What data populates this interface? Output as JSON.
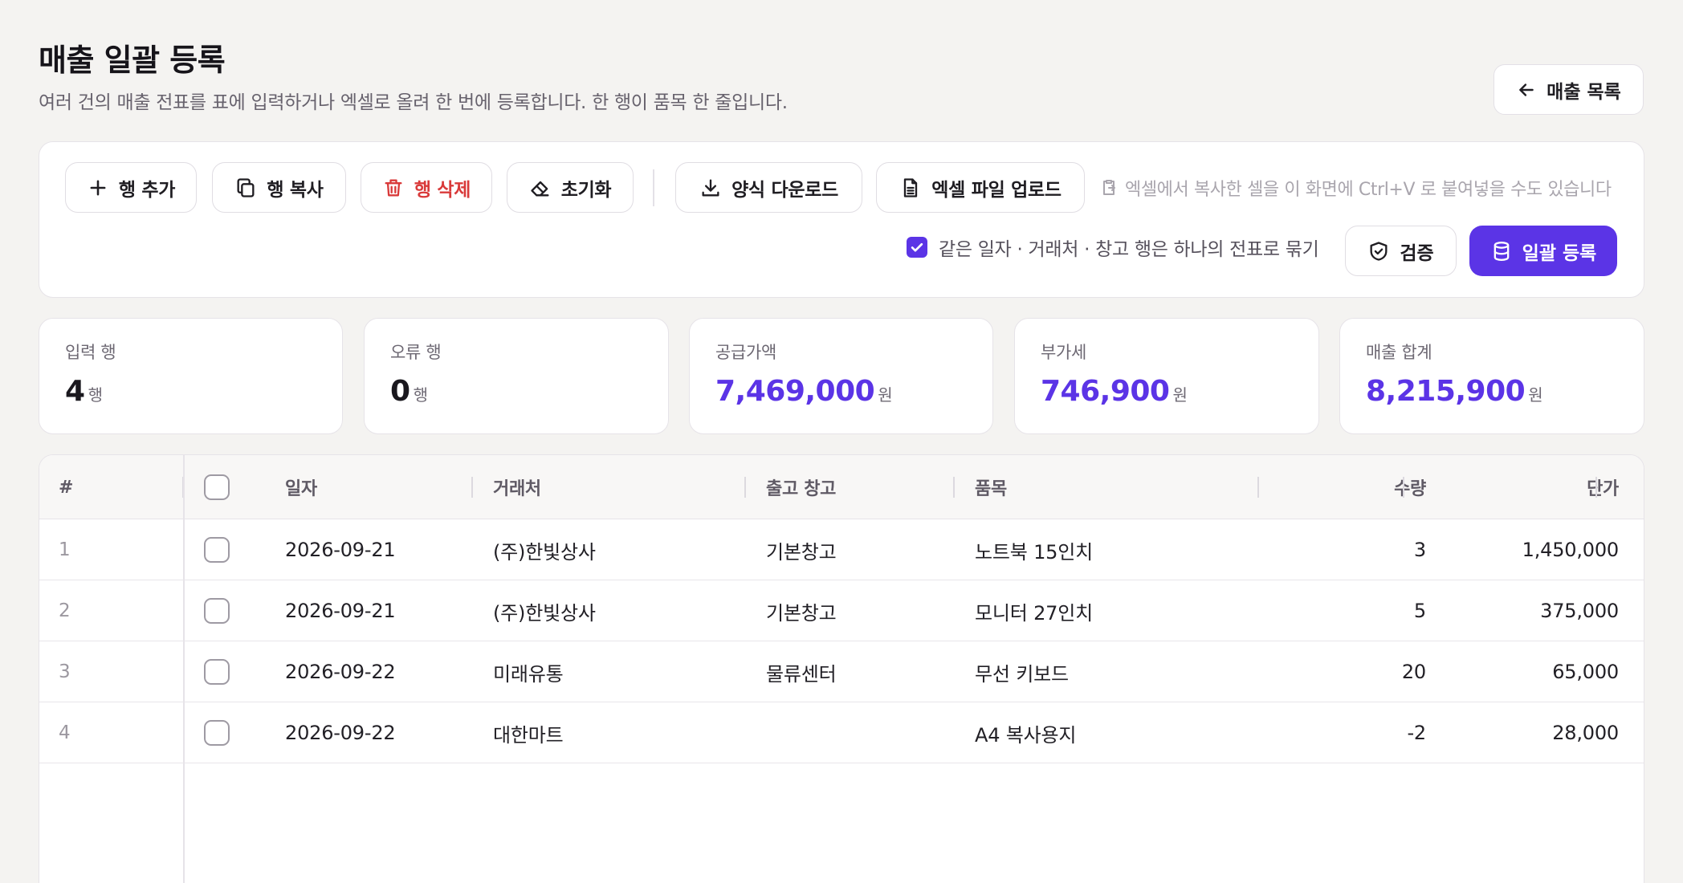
{
  "header": {
    "title": "매출 일괄 등록",
    "subtitle": "여러 건의 매출 전표를 표에 입력하거나 엑셀로 올려 한 번에 등록합니다. 한 행이 품목 한 줄입니다.",
    "back_label": "매출 목록"
  },
  "toolbar": {
    "add_row": "행 추가",
    "copy_row": "행 복사",
    "delete_row": "행 삭제",
    "reset": "초기화",
    "download_template": "양식 다운로드",
    "upload_excel": "엑셀 파일 업로드",
    "paste_hint": "엑셀에서 복사한 셀을 이 화면에 Ctrl+V 로 붙여넣을 수도 있습니다",
    "group_option_label": "같은 일자 · 거래처 · 창고 행은 하나의 전표로 묶기",
    "group_option_checked": true,
    "validate": "검증",
    "submit": "일괄 등록"
  },
  "stats": {
    "input_rows": {
      "label": "입력 행",
      "value": "4",
      "unit": "행"
    },
    "error_rows": {
      "label": "오류 행",
      "value": "0",
      "unit": "행"
    },
    "supply_amount": {
      "label": "공급가액",
      "value": "7,469,000",
      "unit": "원"
    },
    "vat": {
      "label": "부가세",
      "value": "746,900",
      "unit": "원"
    },
    "total": {
      "label": "매출 합계",
      "value": "8,215,900",
      "unit": "원"
    }
  },
  "table": {
    "columns": {
      "num": "#",
      "date": "일자",
      "customer": "거래처",
      "warehouse": "출고 창고",
      "item": "품목",
      "qty": "수량",
      "price": "단가"
    },
    "rows": [
      {
        "num": "1",
        "date": "2026-09-21",
        "customer": "(주)한빛상사",
        "warehouse": "기본창고",
        "item": "노트북 15인치",
        "qty": "3",
        "price": "1,450,000"
      },
      {
        "num": "2",
        "date": "2026-09-21",
        "customer": "(주)한빛상사",
        "warehouse": "기본창고",
        "item": "모니터 27인치",
        "qty": "5",
        "price": "375,000"
      },
      {
        "num": "3",
        "date": "2026-09-22",
        "customer": "미래유통",
        "warehouse": "물류센터",
        "item": "무선 키보드",
        "qty": "20",
        "price": "65,000"
      },
      {
        "num": "4",
        "date": "2026-09-22",
        "customer": "대한마트",
        "warehouse": "",
        "item": "A4 복사용지",
        "qty": "-2",
        "price": "28,000"
      }
    ]
  },
  "colors": {
    "accent": "#5b34e6",
    "danger": "#d93a3a",
    "background": "#f4f3f1"
  }
}
